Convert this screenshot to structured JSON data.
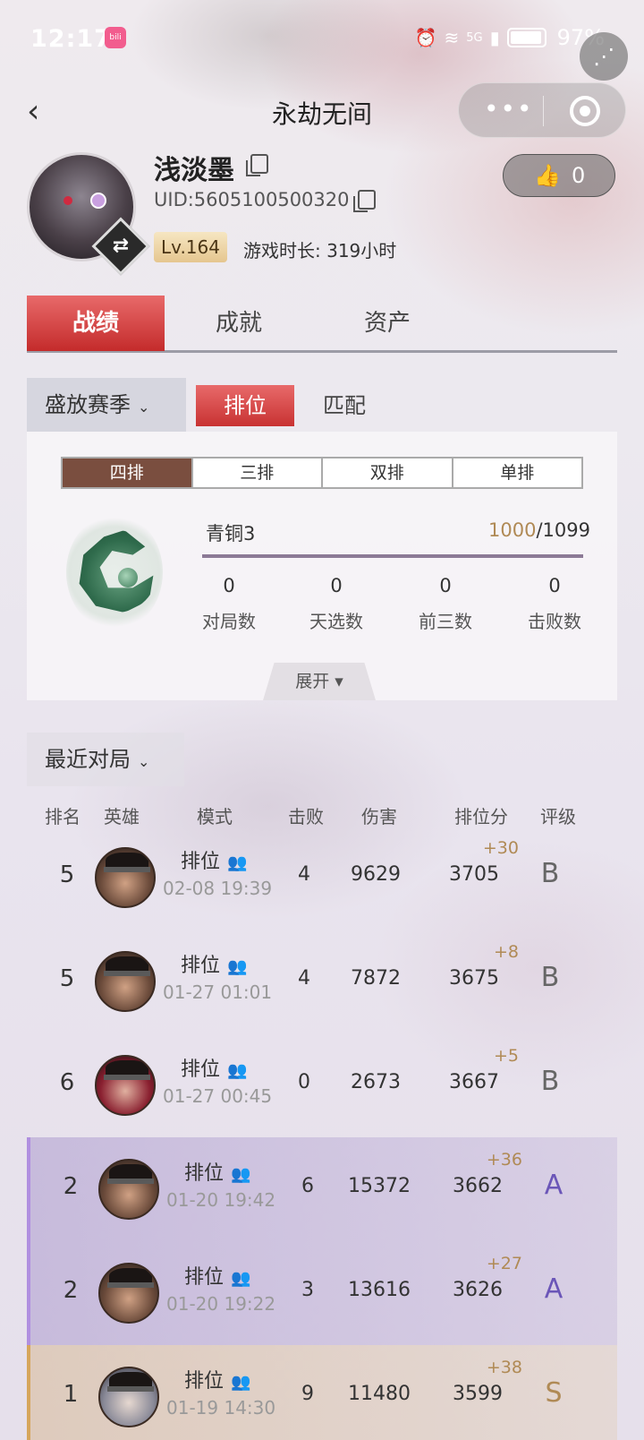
{
  "status_bar": {
    "time": "12:17",
    "app_badge": "bilibili",
    "network": "5G",
    "battery": "97%"
  },
  "nav": {
    "title": "永劫无间"
  },
  "profile": {
    "name": "浅淡墨",
    "uid": "UID:5605100500320",
    "level": "Lv.164",
    "playtime": "游戏时长: 319小时",
    "likes": "0"
  },
  "main_tabs": [
    {
      "label": "战绩"
    },
    {
      "label": "成就"
    },
    {
      "label": "资产"
    }
  ],
  "season": {
    "selected": "盛放赛季",
    "modes": [
      {
        "label": "排位"
      },
      {
        "label": "匹配"
      }
    ]
  },
  "rank_card": {
    "team_tabs": [
      {
        "label": "四排"
      },
      {
        "label": "三排"
      },
      {
        "label": "双排"
      },
      {
        "label": "单排"
      }
    ],
    "rank_name": "青铜3",
    "points_current": "1000",
    "points_total": "/1099",
    "stats": [
      {
        "value": "0",
        "label": "对局数"
      },
      {
        "value": "0",
        "label": "天选数"
      },
      {
        "value": "0",
        "label": "前三数"
      },
      {
        "value": "0",
        "label": "击败数"
      }
    ],
    "expand_label": "展开 ▾"
  },
  "recent": {
    "selected": "最近对局",
    "columns": {
      "rank": "排名",
      "hero": "英雄",
      "mode": "模式",
      "kills": "击败",
      "damage": "伤害",
      "score": "排位分",
      "grade": "评级"
    },
    "matches": [
      {
        "rank": "5",
        "mode": "排位",
        "time": "02-08 19:39",
        "kills": "4",
        "damage": "9629",
        "delta": "+30",
        "score": "3705",
        "grade": "B",
        "tier": "b",
        "hero_style": ""
      },
      {
        "rank": "5",
        "mode": "排位",
        "time": "01-27 01:01",
        "kills": "4",
        "damage": "7872",
        "delta": "+8",
        "score": "3675",
        "grade": "B",
        "tier": "b",
        "hero_style": ""
      },
      {
        "rank": "6",
        "mode": "排位",
        "time": "01-27 00:45",
        "kills": "0",
        "damage": "2673",
        "delta": "+5",
        "score": "3667",
        "grade": "B",
        "tier": "b",
        "hero_style": "red"
      },
      {
        "rank": "2",
        "mode": "排位",
        "time": "01-20 19:42",
        "kills": "6",
        "damage": "15372",
        "delta": "+36",
        "score": "3662",
        "grade": "A",
        "tier": "a",
        "hero_style": ""
      },
      {
        "rank": "2",
        "mode": "排位",
        "time": "01-20 19:22",
        "kills": "3",
        "damage": "13616",
        "delta": "+27",
        "score": "3626",
        "grade": "A",
        "tier": "a",
        "hero_style": ""
      },
      {
        "rank": "1",
        "mode": "排位",
        "time": "01-19 14:30",
        "kills": "9",
        "damage": "11480",
        "delta": "+38",
        "score": "3599",
        "grade": "S",
        "tier": "s",
        "hero_style": "silver"
      }
    ]
  },
  "colors": {
    "accent_red": "#c42b2b",
    "grade_b": "#666666",
    "grade_a": "#6b56b8",
    "grade_s": "#b08a55",
    "delta": "#b08a55"
  },
  "icons": [
    "back-icon",
    "more-dots-icon",
    "close-target-icon",
    "share-icon",
    "copy-icon",
    "swap-icon",
    "thumb-up-icon",
    "chevron-down-icon",
    "team-icon"
  ]
}
